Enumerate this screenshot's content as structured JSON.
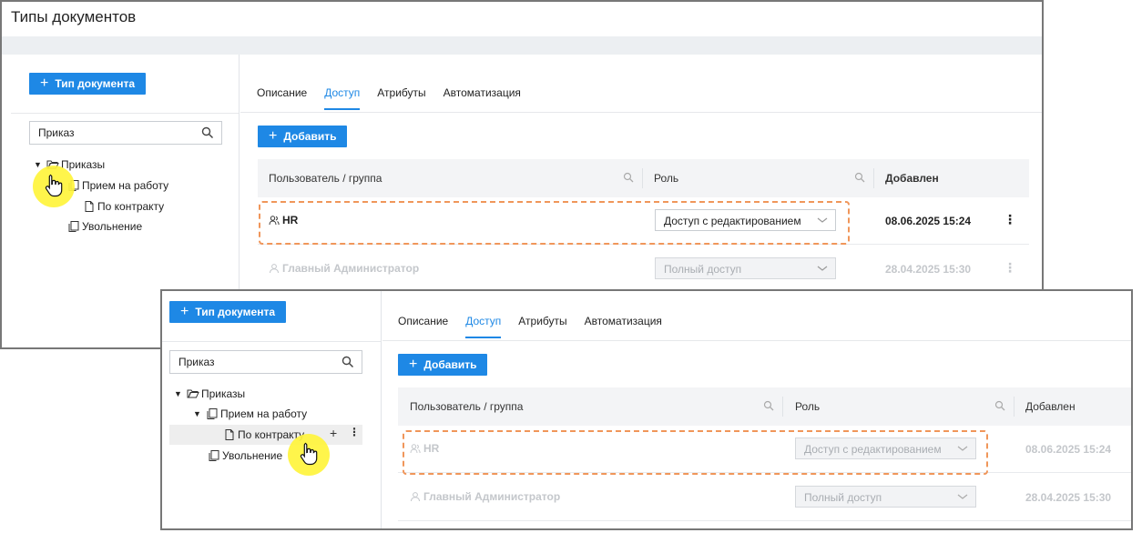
{
  "window": {
    "title": "Типы документов"
  },
  "left": {
    "add_type_label": "Тип документа",
    "search_value": "Приказ",
    "tree": {
      "root": "Приказы",
      "child1": "Прием на работу",
      "child1_1": "По контракту",
      "child2": "Увольнение"
    }
  },
  "tabs": [
    "Описание",
    "Доступ",
    "Атрибуты",
    "Автоматизация"
  ],
  "active_tab": "Доступ",
  "add_label": "Добавить",
  "table": {
    "col_user": "Пользователь / группа",
    "col_role": "Роль",
    "col_added": "Добавлен",
    "rows": [
      {
        "user": "HR",
        "role": "Доступ с редактированием",
        "added": "08.06.2025 15:24"
      },
      {
        "user": "Главный Администратор",
        "role": "Полный доступ",
        "added": "28.04.2025 15:30"
      }
    ]
  },
  "tree_tools": {
    "add": "+",
    "more": "⋮"
  },
  "colors": {
    "accent": "#1e88e5",
    "highlight": "#f0965a",
    "cursor": "#fff43c"
  }
}
